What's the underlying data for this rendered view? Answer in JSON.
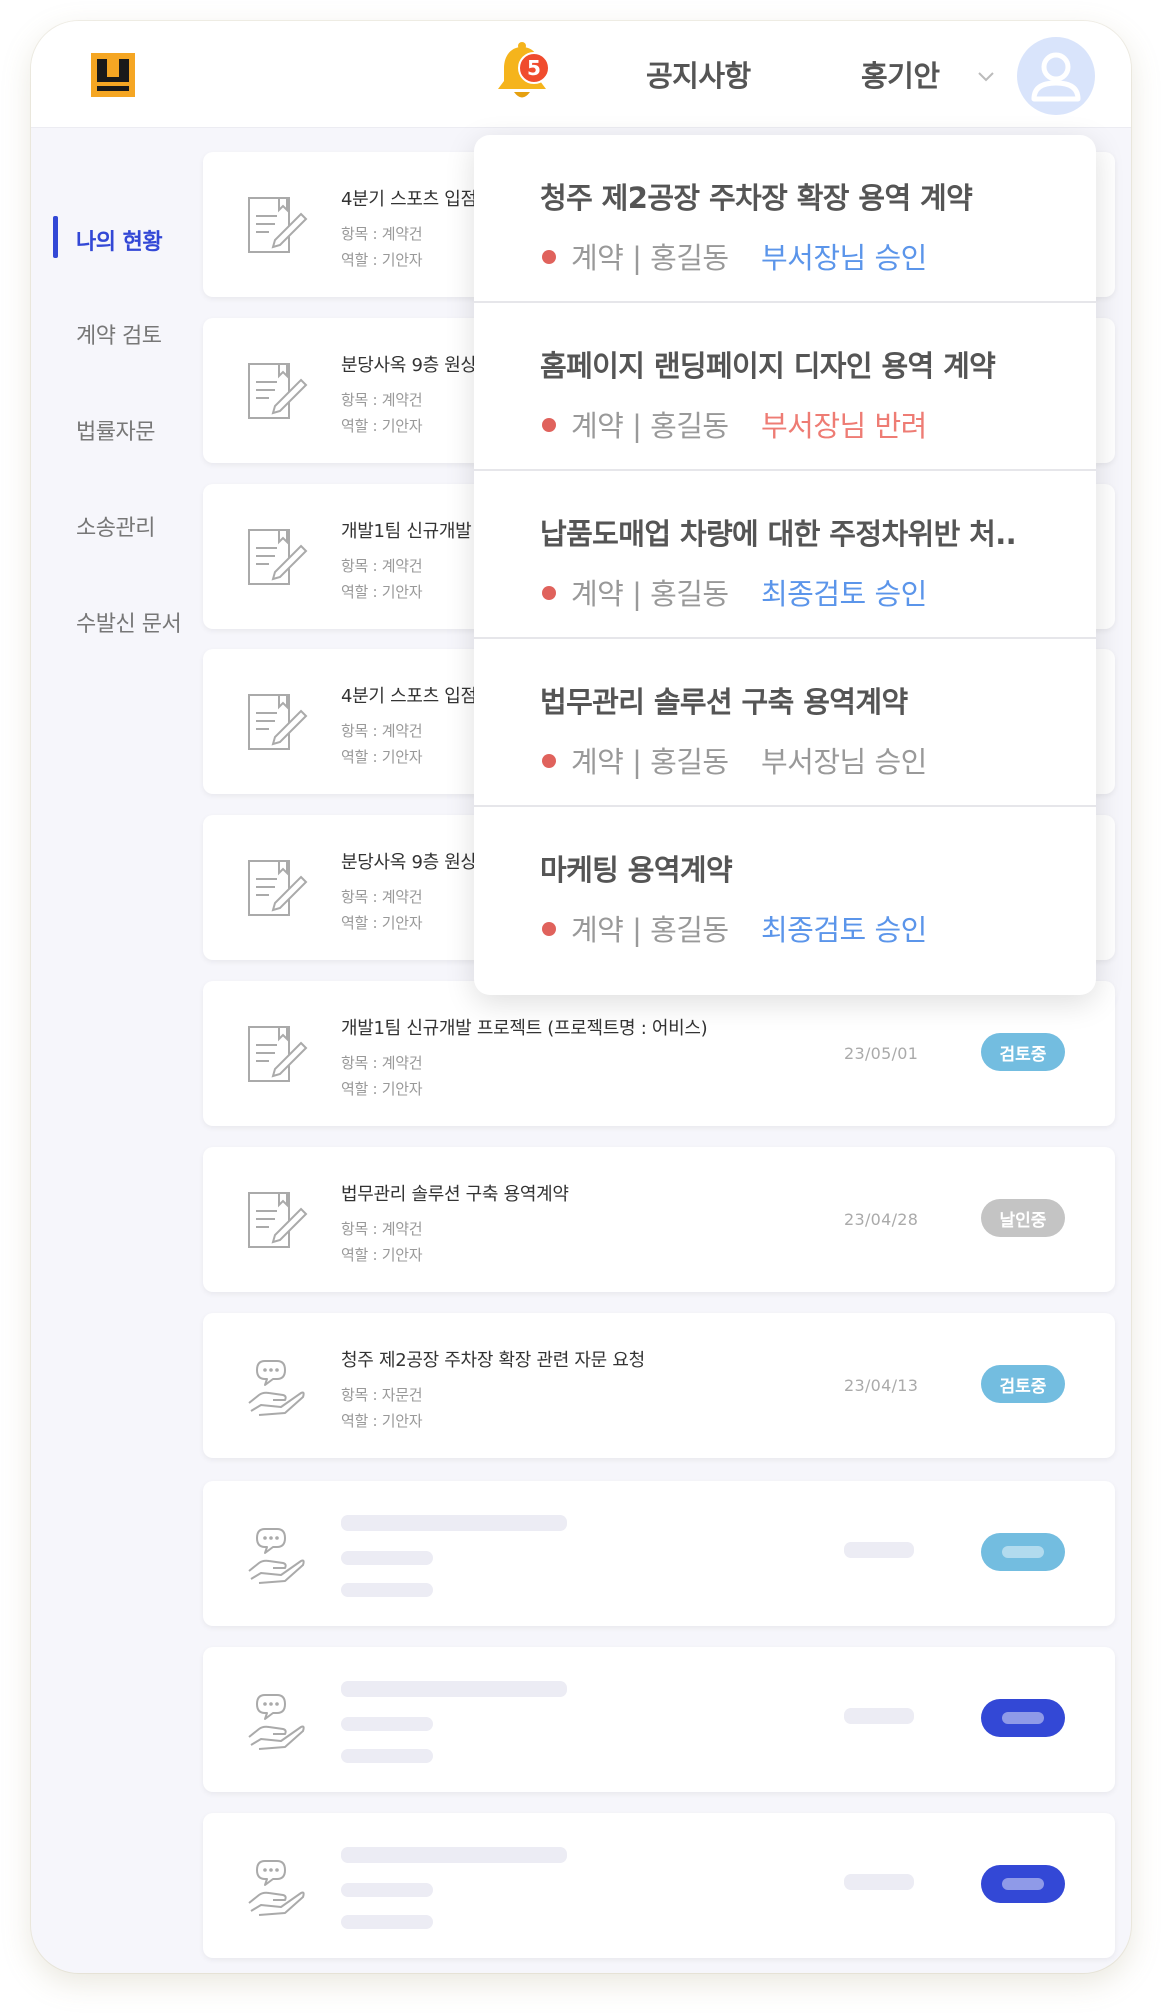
{
  "header": {
    "notification_count": "5",
    "notice_label": "공지사항",
    "user_name": "홍기안"
  },
  "sidebar": {
    "items": [
      {
        "label": "나의 현황",
        "active": true
      },
      {
        "label": "계약 검토",
        "active": false
      },
      {
        "label": "법률자문",
        "active": false
      },
      {
        "label": "소송관리",
        "active": false
      },
      {
        "label": "수발신 문서",
        "active": false
      }
    ]
  },
  "cards": [
    {
      "title": "4분기 스포츠 입점",
      "meta1": "항목 : 계약건",
      "meta2": "역할 : 기안자",
      "icon": "document-pen-icon"
    },
    {
      "title": "분당사옥 9층 원상",
      "meta1": "항목 : 계약건",
      "meta2": "역할 : 기안자",
      "icon": "document-pen-icon"
    },
    {
      "title": "개발1팀 신규개발",
      "meta1": "항목 : 계약건",
      "meta2": "역할 : 기안자",
      "icon": "document-pen-icon"
    },
    {
      "title": "4분기 스포츠 입점",
      "meta1": "항목 : 계약건",
      "meta2": "역할 : 기안자",
      "icon": "document-pen-icon"
    },
    {
      "title": "분당사옥 9층 원상",
      "meta1": "항목 : 계약건",
      "meta2": "역할 : 기안자",
      "icon": "document-pen-icon"
    },
    {
      "title": "개발1팀 신규개발 프로젝트 (프로젝트명 : 어비스)",
      "meta1": "항목 : 계약건",
      "meta2": "역할 : 기안자",
      "date": "23/05/01",
      "status": "검토중",
      "status_color": "#73bde0",
      "icon": "document-pen-icon"
    },
    {
      "title": "법무관리 솔루션 구축 용역계약",
      "meta1": "항목 : 계약건",
      "meta2": "역할 : 기안자",
      "date": "23/04/28",
      "status": "날인중",
      "status_color": "#c4c4c4",
      "icon": "document-pen-icon"
    },
    {
      "title": "청주 제2공장 주차장 확장 관련 자문 요청",
      "meta1": "항목 : 자문건",
      "meta2": "역할 : 기안자",
      "date": "23/04/13",
      "status": "검토중",
      "status_color": "#73bde0",
      "icon": "hand-chat-icon"
    }
  ],
  "skeleton_cards": [
    {
      "badge_color": "#73bde0",
      "icon": "hand-chat-icon"
    },
    {
      "badge_color": "#3348d6",
      "icon": "hand-chat-icon"
    },
    {
      "badge_color": "#3348d6",
      "icon": "hand-chat-icon"
    }
  ],
  "notifications": [
    {
      "title": "청주 제2공장 주차장 확장 용역 계약",
      "meta": "계약 | 홍길동",
      "status": "부서장님 승인",
      "status_color": "#5b95ea"
    },
    {
      "title": "홈페이지 랜딩페이지 디자인 용역 계약",
      "meta": "계약 | 홍길동",
      "status": "부서장님 반려",
      "status_color": "#ee7c74"
    },
    {
      "title": "납품도매업 차량에 대한 주정차위반 처..",
      "meta": "계약 | 홍길동",
      "status": "최종검토 승인",
      "status_color": "#5b95ea"
    },
    {
      "title": "법무관리 솔루션 구축 용역계약",
      "meta": "계약 | 홍길동",
      "status": "부서장님 승인",
      "status_color": "#999999"
    },
    {
      "title": "마케팅 용역계약",
      "meta": "계약 | 홍길동",
      "status": "최종검토 승인",
      "status_color": "#5b95ea"
    }
  ],
  "colors": {
    "accent": "#3348d6",
    "bell": "#f5b41c",
    "badge_red": "#f04c2e",
    "menu_orange": "#f5a623"
  }
}
